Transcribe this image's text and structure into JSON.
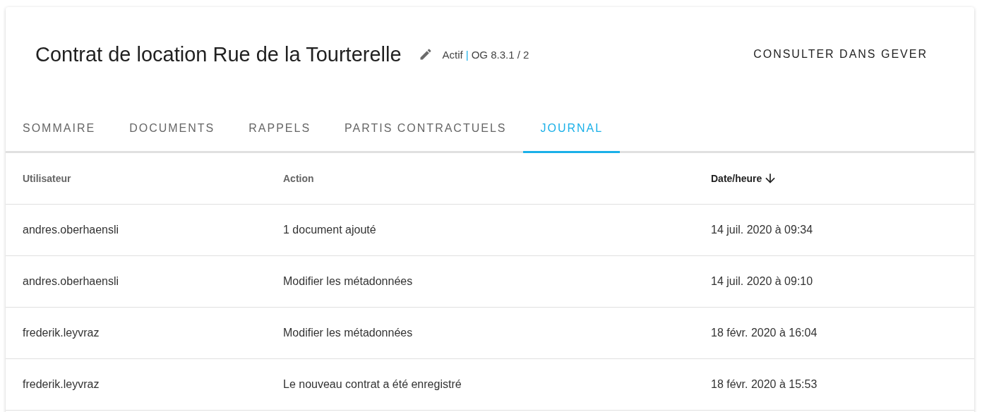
{
  "header": {
    "title": "Contrat de location Rue de la Tourterelle",
    "status": "Actif",
    "separator": "|",
    "reference": "OG 8.3.1 / 2",
    "action": "CONSULTER DANS GEVER"
  },
  "tabs": [
    {
      "label": "SOMMAIRE",
      "selected": false
    },
    {
      "label": "DOCUMENTS",
      "selected": false
    },
    {
      "label": "RAPPELS",
      "selected": false
    },
    {
      "label": "PARTIS CONTRACTUELS",
      "selected": false
    },
    {
      "label": "JOURNAL",
      "selected": true
    }
  ],
  "table": {
    "columns": [
      {
        "label": "Utilisateur",
        "sorted": false
      },
      {
        "label": "Action",
        "sorted": false
      },
      {
        "label": "Date/heure",
        "sorted": true
      }
    ],
    "rows": [
      [
        "andres.oberhaensli",
        "1 document ajouté",
        "14 juil. 2020 à 09:34"
      ],
      [
        "andres.oberhaensli",
        "Modifier les métadonnées",
        "14 juil. 2020 à 09:10"
      ],
      [
        "frederik.leyvraz",
        "Modifier les métadonnées",
        "18 févr. 2020 à 16:04"
      ],
      [
        "frederik.leyvraz",
        "Le nouveau contrat a été enregistré",
        "18 févr. 2020 à 15:53"
      ]
    ]
  }
}
